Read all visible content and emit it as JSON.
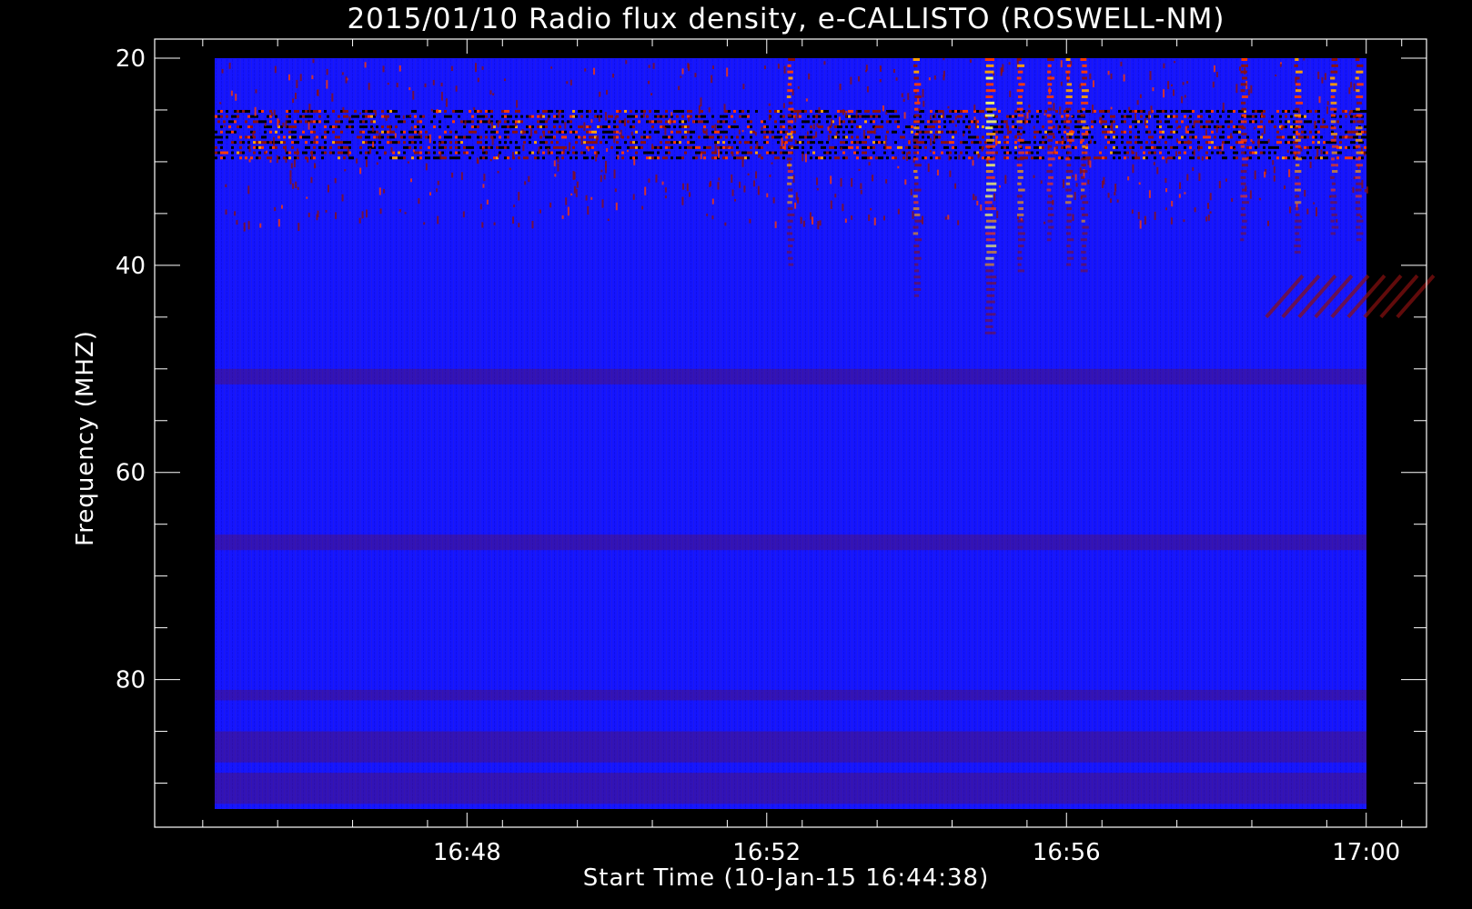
{
  "chart_data": {
    "type": "heatmap",
    "title": "2015/01/10  Radio flux density, e-CALLISTO (ROSWELL-NM)",
    "xlabel": "Start Time (10-Jan-15 16:44:38)",
    "ylabel": "Frequency (MHZ)",
    "x_tick_labels": [
      "16:48",
      "16:52",
      "16:56",
      "17:00"
    ],
    "x_ticks_minutes": [
      -1.5,
      3.5,
      7.5,
      11.5,
      15.5
    ],
    "y_tick_labels": [
      "20",
      "40",
      "60",
      "80"
    ],
    "y_ticks": [
      20,
      40,
      60,
      80
    ],
    "x_range_minutes": [
      0,
      15.37
    ],
    "y_range_mhz": [
      20,
      92.5
    ],
    "y_inverted": true,
    "colormap": [
      "#000000",
      "#1414ff",
      "#1a1aef",
      "#8a1010",
      "#ff3a00",
      "#ffa000",
      "#ffff60"
    ],
    "background_level": "blue",
    "interference_band_mhz": [
      25,
      30
    ],
    "bursts": [
      {
        "time": "16:52:19",
        "f_low": 20,
        "f_high": 40,
        "intensity": "medium"
      },
      {
        "time": "16:54:00",
        "f_low": 20,
        "f_high": 43,
        "intensity": "medium"
      },
      {
        "time": "16:54:59",
        "f_low": 20,
        "f_high": 47,
        "intensity": "strong"
      },
      {
        "time": "16:55:23",
        "f_low": 20,
        "f_high": 41,
        "intensity": "medium"
      },
      {
        "time": "16:55:47",
        "f_low": 20,
        "f_high": 38,
        "intensity": "weak"
      },
      {
        "time": "16:56:02",
        "f_low": 20,
        "f_high": 40,
        "intensity": "medium"
      },
      {
        "time": "16:56:14",
        "f_low": 20,
        "f_high": 41,
        "intensity": "medium"
      },
      {
        "time": "16:58:22",
        "f_low": 20,
        "f_high": 38,
        "intensity": "weak"
      },
      {
        "time": "16:59:05",
        "f_low": 20,
        "f_high": 39,
        "intensity": "medium"
      },
      {
        "time": "16:59:34",
        "f_low": 20,
        "f_high": 37,
        "intensity": "medium"
      },
      {
        "time": "16:59:54",
        "f_low": 20,
        "f_high": 38,
        "intensity": "medium"
      }
    ],
    "grid": false,
    "legend": "none"
  }
}
